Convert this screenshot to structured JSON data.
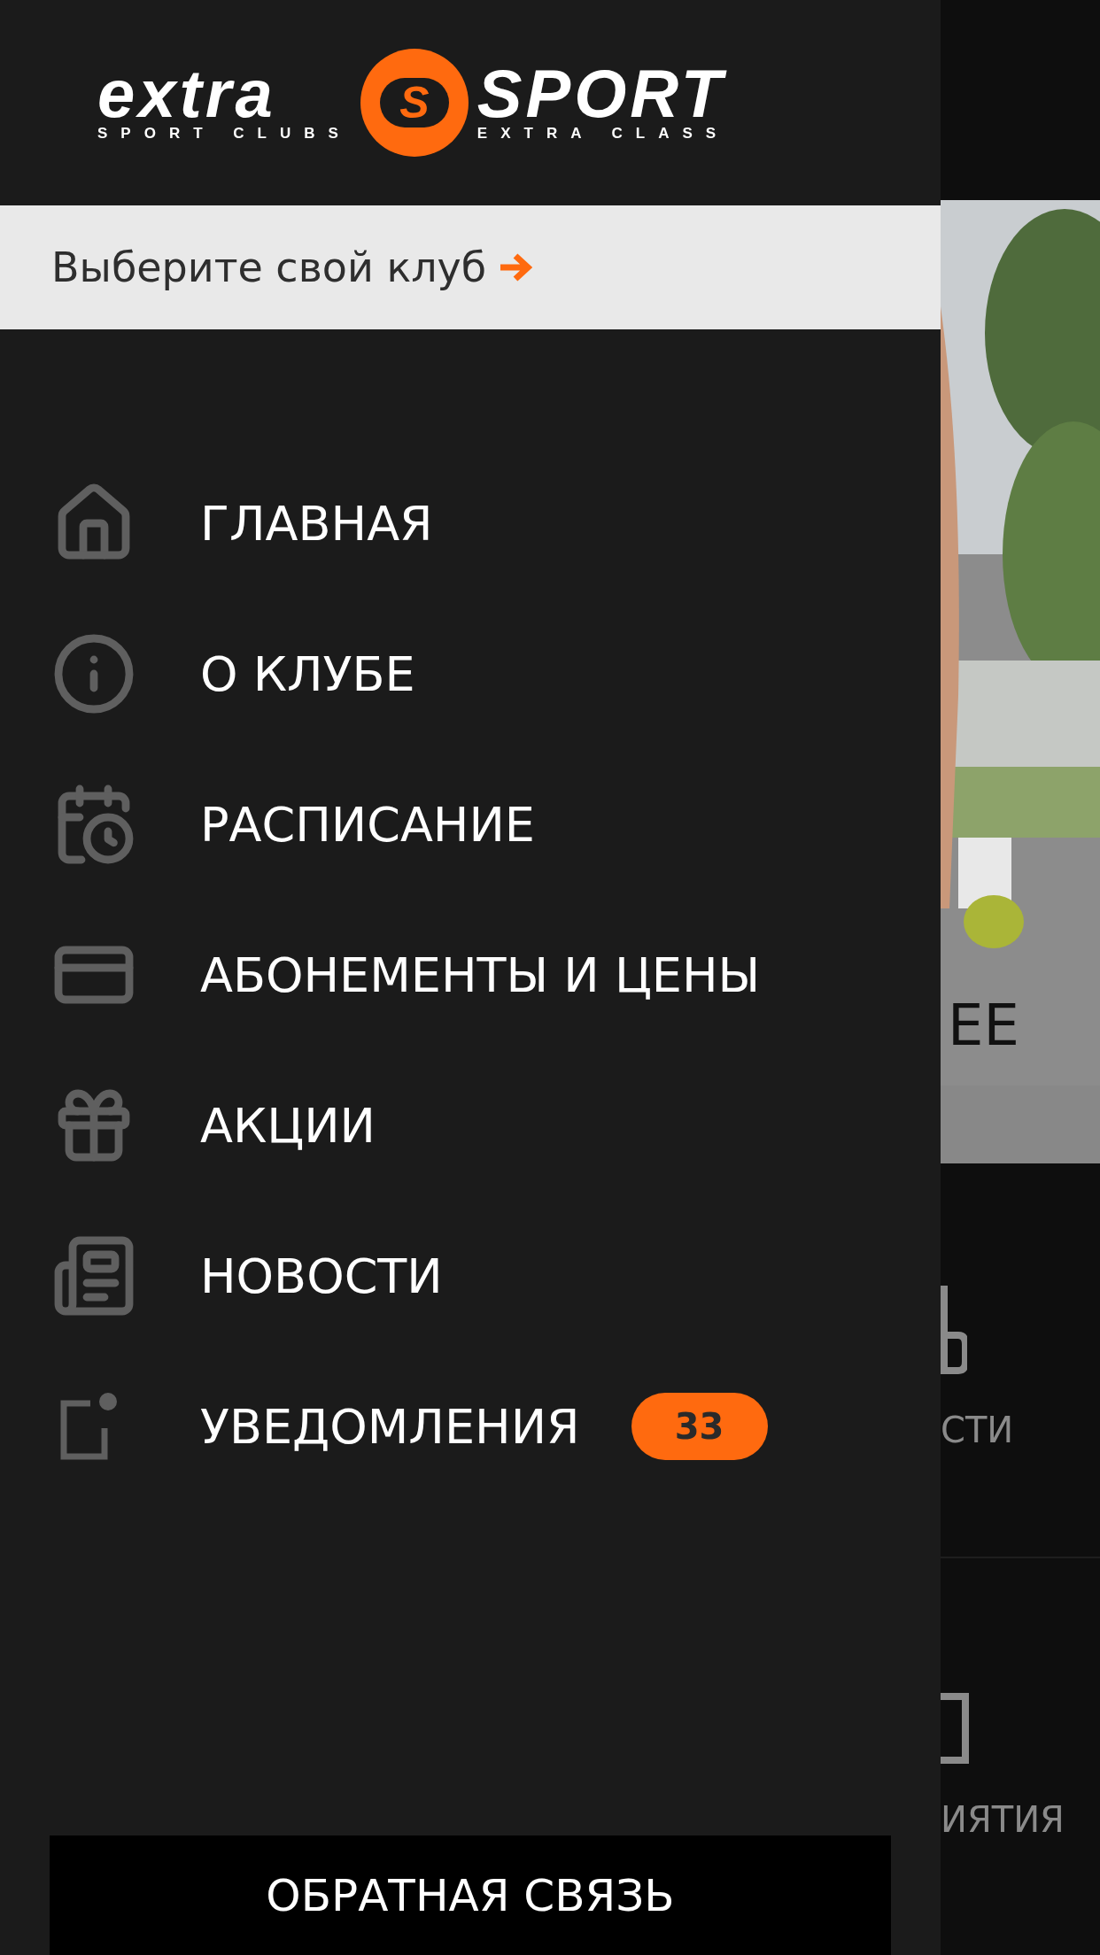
{
  "logo": {
    "word_left": "extra",
    "emblem": "S",
    "word_right": "SPORT",
    "tagline_left": "SPORT CLUBS",
    "tagline_right": "EXTRA CLASS"
  },
  "club_picker": {
    "label": "Выберите свой клуб"
  },
  "menu": [
    {
      "label": "ГЛАВНАЯ"
    },
    {
      "label": "О КЛУБЕ"
    },
    {
      "label": "РАСПИСАНИЕ"
    },
    {
      "label": "АБОНЕМЕНТЫ И ЦЕНЫ"
    },
    {
      "label": "АКЦИИ"
    },
    {
      "label": "НОВОСТИ"
    },
    {
      "label": "УВЕДОМЛЕНИЯ",
      "badge": "33"
    }
  ],
  "feedback_button": {
    "label": "ОБРАТНАЯ СВЯЗЬ"
  },
  "background": {
    "banner_text": "ЕЕ",
    "tile_labels": [
      "СТИ",
      "ИЯТИЯ"
    ]
  }
}
